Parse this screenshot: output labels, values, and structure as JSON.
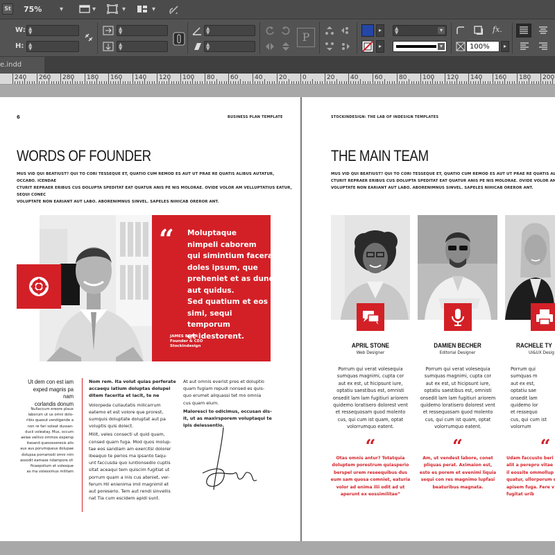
{
  "app": {
    "badge": "St",
    "zoom": "75%"
  },
  "control_panel": {
    "w_label": "W:",
    "h_label": "H:",
    "stroke_percent": "100%",
    "fx_label": "fx."
  },
  "document_tab": {
    "label": "e.indd"
  },
  "ruler": {
    "labels": [
      "240",
      "260",
      "280",
      "180",
      "160",
      "140",
      "120",
      "100",
      "80",
      "60",
      "40",
      "20",
      "0",
      "20",
      "40",
      "60",
      "80",
      "100",
      "120",
      "140",
      "160",
      "180",
      "200"
    ]
  },
  "left_page": {
    "page_number": "6",
    "running_head": "Business Plan Template",
    "title": "WORDS OF FOUNDER",
    "intro_lines": [
      "Mus vid qui beatiust? Qui to cori tesseque et, quatio cum remod es aut ut prae re quatis alibus autatur, occabo. Icendae",
      "cturit repraer eribus cus dolupta speditat eat quatur anis pe nis molorae. Ovide volor am velluptatius eatur, sequi conec",
      "voluptate non eariant aut labo. Aborenimnus sinvel. Sapeles nihicab oreror ant."
    ],
    "quote_mark": "“",
    "quote_lines": [
      "Moluptaque",
      "nimpeli caborem",
      "qui simintium facerate",
      "doles ipsum, que",
      "preheniet et as dundit",
      "aut quidus.",
      "Sed quatium et eos",
      "simi, sequi temporum",
      "et idestorent."
    ],
    "quote_author": "JAMES BLAIR",
    "quote_role_1": "Founder & CEO",
    "quote_role_2": "Stockindesign",
    "sidebar_head_lines": [
      "Ut dem con est iam",
      "exped magnis pa nam",
      "corlandis donum"
    ],
    "sidebar_text_lines": [
      "Nullaccum ereore plaux",
      "laborum ut us omni dolo-",
      "ribis quaeut vendigende a",
      "non re fari soleat dussan-",
      "ducii voleatay. Mus, occum",
      "aelae veliivo ommos expersp",
      "itasand quesosseresis alis",
      "aus aus porumqueus dolupae",
      "dolupsa porramodi omni nim",
      "assodit eamase ndampore of-",
      "ficaepolium et volesque",
      "as ma volessimus militam"
    ],
    "col2_lead": [
      "Nom rem. Ita volut quias perferate",
      "accaequ iatium doluptas dolupel",
      "ditem facerita et lacit, te ne"
    ],
    "col2_body": [
      "Volorpeda cullautatis milicarrum",
      "eatemo et est volore que prorest,",
      "sumquis doluptate doluptat aut pa",
      "voluptis quis dolect.",
      "Milit, veles consecti ut quid quam,",
      "consed quam fuga. Mod quos molup-",
      "tae eos sandiam am exercitsi dolorer",
      "ibeaquo te perios ma ipsanto taqu-",
      "unt faccusda quo iuntionsedio cuptis",
      "sitat aceaqui tem quiscim fugitiat ut",
      "porrum quam a inis cus ateniet, ver-",
      "ferum Hil enienima imil magnimil et",
      "aut poreserio. Tem aut rendi sinvellis",
      "nat Tia cum escidem apidi sunt."
    ],
    "col3_body": [
      "At aut omnis everist pres et doluptio",
      "quam fugiam repudi nonsed es quis-",
      "quo erumet aliquassi tet mo omnia",
      "cus quam eium."
    ],
    "col3_bold": [
      "Maloresci to odicimus, occusan dis-",
      "it, ut as maxirsporem voluptaqui te",
      "ipis delessentio."
    ]
  },
  "right_page": {
    "running_head": "StockInDesign: The LAB Of InDesign Templates",
    "title": "THE MAIN TEAM",
    "intro_lines": [
      "Mus vid qui beatiust? Qui to cori tesseque et, quatio cum remod es aut ut prae re quatis alibus autatur, occabo. Icendae",
      "cturit repraer eribus cus dolupta speditat eat quatur anis pe nis molorae. Ovide volor am velluptatius eatur, sequi conec",
      "voluptate non eariant aut labo. Aborenimnus sinvel. Sapeles nihicab oreror ant."
    ],
    "team": [
      {
        "name": "APRIL STONE",
        "role": "Web Designer",
        "icon": "chat-icon",
        "body": [
          "Porrum qui verat volesequia",
          "sumquas magnimi, cupta cor",
          "aut ex est, ut hicipsunt iure,",
          "optatiu saestibus est, omnisti",
          "onsedit lam lam fugitiuri ariorem",
          "quidemo loratisero dolorest vent",
          "et ressequosam quod molento",
          "cus, qui cum ist quam, optat",
          "volorrumquo eatent."
        ],
        "quote_mark": "“",
        "quote": [
          "Otas omnis antur? Totatquia",
          "doluptem porestrum quiasperio",
          "berspel urem reseequibus dus",
          "eum sam quosa comniet, eaturia",
          "volor ad enima ilii odit ad ut",
          "aperunt ex eossimilitae”"
        ]
      },
      {
        "name": "DAMIEN BECHER",
        "role": "Editorial Designer",
        "icon": "microphone-icon",
        "body": [
          "Porrum qui verat volesequia",
          "sumquas magnimi, cupta cor",
          "aut ex est, ut hicipsunt iure,",
          "optatiu saestibus est, omnisti",
          "onsedit lam lam fugitiuri ariorem",
          "quidemo loratisero dolorest vent",
          "et ressequosam quod molento",
          "cus, qui cum ist quam, optat",
          "volorrumquo eatent."
        ],
        "quote_mark": "“",
        "quote": [
          "Am, ut vendest labore, conet",
          "pliquas perat. Aximaion est,",
          "esto es porem et evenimi liquia",
          "sequi con res magnimo lupfasi",
          "beaturibus magnata."
        ]
      },
      {
        "name": "RACHELE TY",
        "role": "UI&UX Desig",
        "icon": "printer-icon",
        "body": [
          "Porrum qui",
          "sumquas m",
          "aut ex est,",
          "optatiu sae",
          "onsedit lam",
          "quidemo lor",
          "et ressequo",
          "cus, qui cum ist",
          "volorrum"
        ],
        "quote_mark": "“",
        "quote": [
          "Udam faccusto beri",
          "alit a perepro vitae",
          "il eossite ommollup",
          "quatur, ullorporum q",
          "apisem fuga. Fere v",
          "fugitat urib"
        ]
      }
    ]
  }
}
